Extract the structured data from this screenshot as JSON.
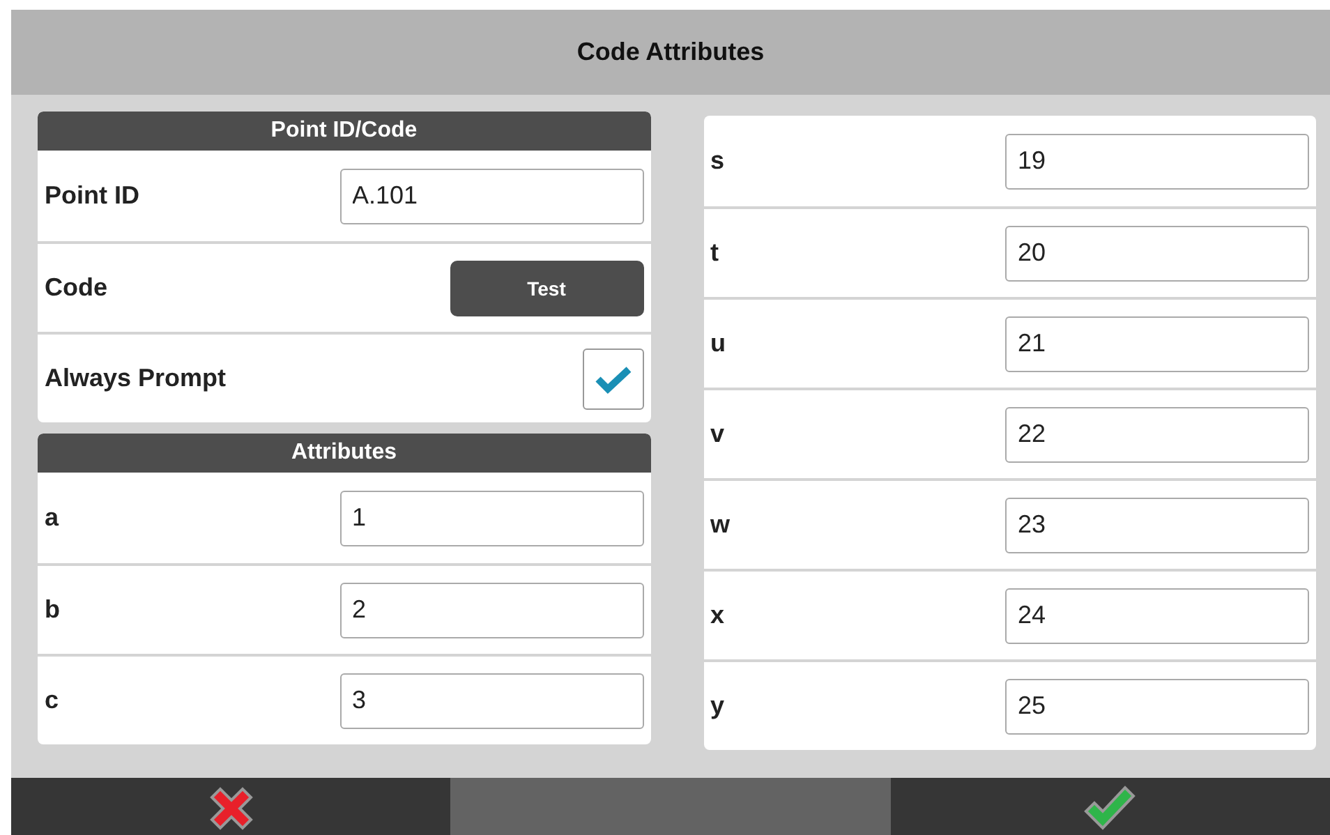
{
  "window": {
    "title": "Code Attributes"
  },
  "point_section": {
    "header": "Point ID/Code",
    "rows": [
      {
        "kind": "field",
        "label": "Point ID",
        "value": "A.101"
      },
      {
        "kind": "button",
        "label": "Code",
        "button": "Test"
      },
      {
        "kind": "checkbox",
        "label": "Always Prompt",
        "checked": true
      }
    ]
  },
  "attributes_section": {
    "header": "Attributes",
    "rows": [
      {
        "label": "a",
        "value": "1"
      },
      {
        "label": "b",
        "value": "2"
      },
      {
        "label": "c",
        "value": "3"
      }
    ]
  },
  "right_attributes": [
    {
      "label": "s",
      "value": "19"
    },
    {
      "label": "t",
      "value": "20"
    },
    {
      "label": "u",
      "value": "21"
    },
    {
      "label": "v",
      "value": "22"
    },
    {
      "label": "w",
      "value": "23"
    },
    {
      "label": "x",
      "value": "24"
    },
    {
      "label": "y",
      "value": "25"
    }
  ]
}
